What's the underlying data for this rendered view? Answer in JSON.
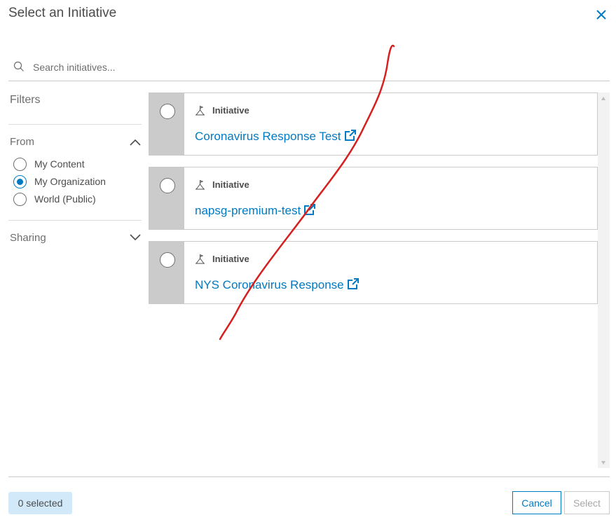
{
  "dialog": {
    "title": "Select an Initiative"
  },
  "search": {
    "placeholder": "Search initiatives..."
  },
  "filters": {
    "title": "Filters",
    "from": {
      "label": "From",
      "expanded": true,
      "options": [
        {
          "label": "My Content",
          "selected": false
        },
        {
          "label": "My Organization",
          "selected": true
        },
        {
          "label": "World (Public)",
          "selected": false
        }
      ]
    },
    "sharing": {
      "label": "Sharing",
      "expanded": false
    }
  },
  "results": [
    {
      "type": "Initiative",
      "name": "Coronavirus Response Test"
    },
    {
      "type": "Initiative",
      "name": "napsg-premium-test"
    },
    {
      "type": "Initiative",
      "name": "NYS Coronavirus Response"
    }
  ],
  "footer": {
    "selected_count": "0 selected",
    "cancel_label": "Cancel",
    "select_label": "Select"
  },
  "colors": {
    "accent": "#007ac2",
    "annotation": "#d62020",
    "badge_bg": "#d2e9f9",
    "card_side": "#cbcbcb"
  },
  "icons": {
    "close": "close-icon",
    "search": "search-icon",
    "initiative": "initiative-icon",
    "external": "external-link-icon",
    "chevron_up": "chevron-up-icon",
    "chevron_down": "chevron-down-icon"
  }
}
